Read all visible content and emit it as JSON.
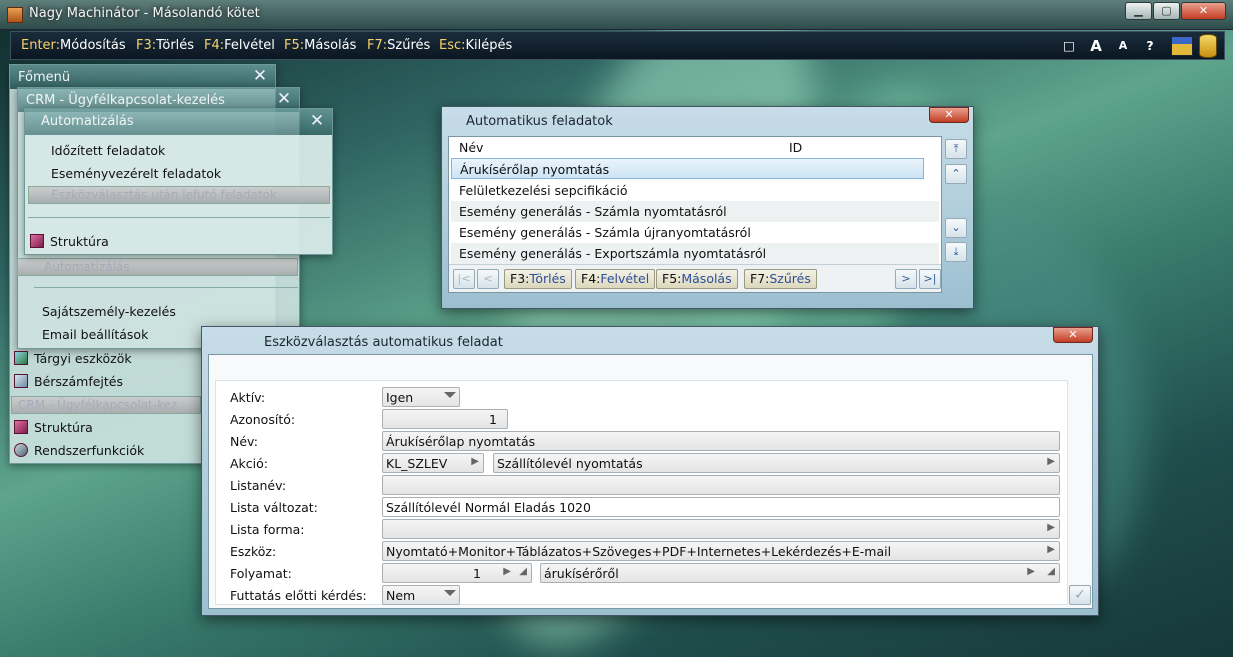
{
  "window": {
    "title": "Nagy Machinátor - Másolandó kötet",
    "minimize": "▁",
    "maximize": "▢",
    "close": "✕"
  },
  "toolbar": {
    "items": [
      {
        "key": "Enter:",
        "label": "Módosítás"
      },
      {
        "key": "F3:",
        "label": "Törlés"
      },
      {
        "key": "F4:",
        "label": "Felvétel"
      },
      {
        "key": "F5:",
        "label": "Másolás"
      },
      {
        "key": "F7:",
        "label": "Szűrés"
      },
      {
        "key": "Esc:",
        "label": "Kilépés"
      }
    ],
    "right_buttons": [
      "□",
      "A",
      "A",
      "?"
    ]
  },
  "menus": {
    "fomenu": {
      "title": "Főmenü",
      "close": "✕"
    },
    "crm": {
      "title": "CRM - Ügyfélkapcsolat-kezelés",
      "close": "✕"
    },
    "automatizalas": {
      "title": "Automatizálás",
      "close": "✕",
      "items": [
        "Időzített feladatok",
        "Eseményvezérelt feladatok"
      ],
      "disabled": "Eszközválasztás után lefutó feladatok",
      "struktura": "Struktúra"
    },
    "crm_items": {
      "disabled": "Automatizálás",
      "items": [
        "Sajátszemély-kezelés",
        "Email beállítások"
      ]
    },
    "main_items": {
      "items": [
        "Tárgyi eszközök",
        "Bérszámfejtés"
      ],
      "disabled": "CRM - Ügyfélkapcsolat-kez",
      "rest": [
        "Struktúra",
        "Rendszerfunkciók"
      ]
    }
  },
  "auto_tasks": {
    "title": "Automatikus feladatok",
    "close": "✕",
    "columns": [
      "Név",
      "ID"
    ],
    "rows": [
      "Árukísérőlap nyomtatás",
      "Felületkezelési sepcifikáció",
      "Esemény generálás - Számla nyomtatásról",
      "Esemény generálás - Számla újranyomtatásról",
      "Esemény generálás - Exportszámla nyomtatásról"
    ],
    "buttons": [
      {
        "key": "F3:",
        "label": "Törlés"
      },
      {
        "key": "F4:",
        "label": "Felvétel"
      },
      {
        "key": "F5:",
        "label": "Másolás"
      },
      {
        "key": "F7:",
        "label": "Szűrés"
      }
    ],
    "nav": {
      "first": "|<",
      "prev": "<",
      "next": ">",
      "last": ">|"
    },
    "scroll": {
      "top": "⤒",
      "up": "⌃",
      "down": "⌄",
      "bottom": "⤓"
    }
  },
  "form": {
    "title": "Eszközválasztás automatikus feladat",
    "close": "✕",
    "labels": {
      "aktiv": "Aktív:",
      "azonosito": "Azonosító:",
      "nev": "Név:",
      "akcio": "Akció:",
      "listanev": "Listanév:",
      "lista_valtozat": "Lista változat:",
      "lista_forma": "Lista forma:",
      "eszkoz": "Eszköz:",
      "folyamat": "Folyamat:",
      "futtatas": "Futtatás előtti kérdés:"
    },
    "values": {
      "aktiv": "Igen",
      "azonosito": "1",
      "nev": "Árukísérőlap nyomtatás",
      "akcio_code": "KL_SZLEV",
      "akcio_name": "Szállítólevél nyomtatás",
      "listanev": "",
      "lista_valtozat": "Szállítólevél Normál Eladás 1020",
      "lista_forma": "",
      "eszkoz": "Nyomtató+Monitor+Táblázatos+Szöveges+PDF+Internetes+Lekérdezés+E-mail",
      "folyamat_num": "1",
      "folyamat_name": "árukísérőről",
      "futtatas": "Nem"
    },
    "ok": "✓"
  }
}
